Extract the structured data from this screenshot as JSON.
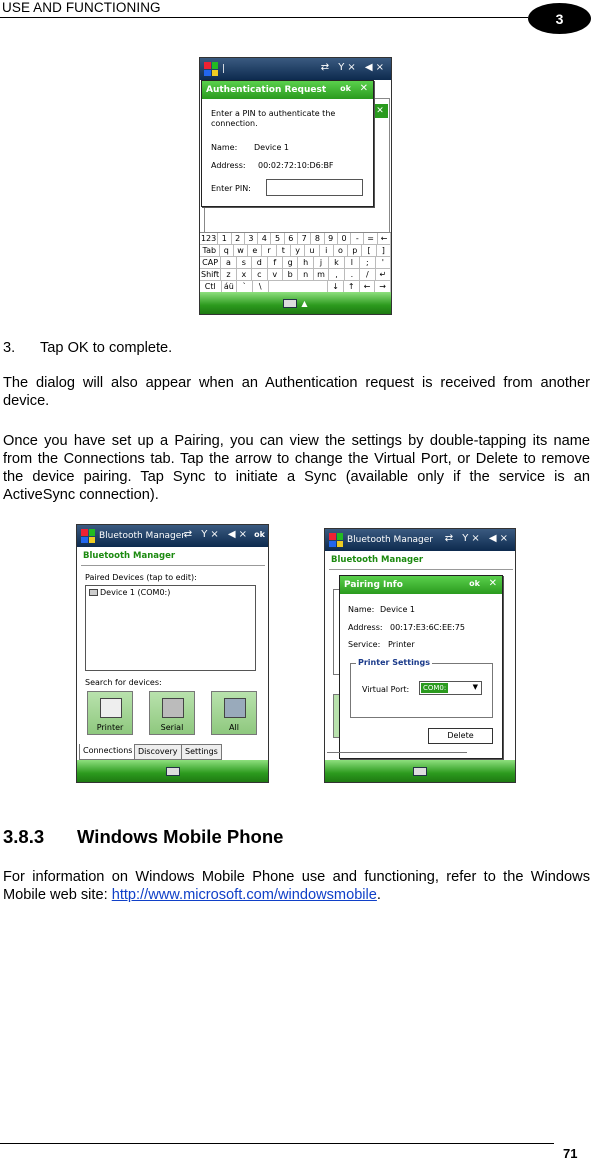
{
  "header": {
    "title": "USE AND FUNCTIONING",
    "chapter": "3"
  },
  "screen1": {
    "dialog_title": "Authentication Request",
    "ok": "ok",
    "prompt": "Enter a PIN to authenticate the connection.",
    "name_label": "Name:",
    "name_value": "Device 1",
    "address_label": "Address:",
    "address_value": "00:02:72:10:D6:BF",
    "pin_label": "Enter PIN:",
    "keyboard_rows": [
      [
        "123",
        "1",
        "2",
        "3",
        "4",
        "5",
        "6",
        "7",
        "8",
        "9",
        "0",
        "-",
        "=",
        "←"
      ],
      [
        "Tab",
        "q",
        "w",
        "e",
        "r",
        "t",
        "y",
        "u",
        "i",
        "o",
        "p",
        "[",
        "]"
      ],
      [
        "CAP",
        "a",
        "s",
        "d",
        "f",
        "g",
        "h",
        "j",
        "k",
        "l",
        ";",
        "'"
      ],
      [
        "Shift",
        "z",
        "x",
        "c",
        "v",
        "b",
        "n",
        "m",
        ",",
        ".",
        "/",
        "↵"
      ],
      [
        "Ctl",
        "áü",
        "`",
        "\\",
        "",
        "↓",
        "↑",
        "←",
        "→"
      ]
    ]
  },
  "step": {
    "number": "3.",
    "text": "Tap OK to complete."
  },
  "paragraphs": {
    "p1": "The dialog will also appear when an Authentication request is received from another device.",
    "p2": "Once you have set up a Pairing, you can view the settings by double-tapping its name from the Connections tab. Tap the arrow to change the Virtual Port, or Delete to remove the device pairing. Tap Sync to initiate a Sync (available only if the service is an ActiveSync connection)."
  },
  "screen2": {
    "app_title": "Bluetooth Manager",
    "ok": "ok",
    "heading": "Bluetooth Manager",
    "paired_label": "Paired Devices (tap to edit):",
    "paired_item": "Device 1 (COM0:)",
    "search_label": "Search for devices:",
    "buttons": [
      "Printer",
      "Serial",
      "All"
    ],
    "tabs": [
      "Connections",
      "Discovery",
      "Settings"
    ]
  },
  "screen3": {
    "app_title": "Bluetooth Manager",
    "heading": "Bluetooth Manager",
    "dialog_title": "Pairing Info",
    "ok": "ok",
    "name_label": "Name:",
    "name_value": "Device 1",
    "address_label": "Address:",
    "address_value": "00:17:E3:6C:EE:75",
    "service_label": "Service:",
    "service_value": "Printer",
    "group_label": "Printer Settings",
    "port_label": "Virtual Port:",
    "port_value": "COM0:",
    "delete_label": "Delete"
  },
  "section": {
    "number": "3.8.3",
    "title": "Windows Mobile Phone",
    "body": "For information on Windows Mobile Phone use and functioning, refer to the Windows Mobile web site: ",
    "link": "http://www.microsoft.com/windowsmobile",
    "after_link": "."
  },
  "footer": {
    "page": "71"
  },
  "colors": {
    "accent_green": "#2a9a1e",
    "title_bar": "#0d2a4e",
    "link": "#1040c8"
  }
}
